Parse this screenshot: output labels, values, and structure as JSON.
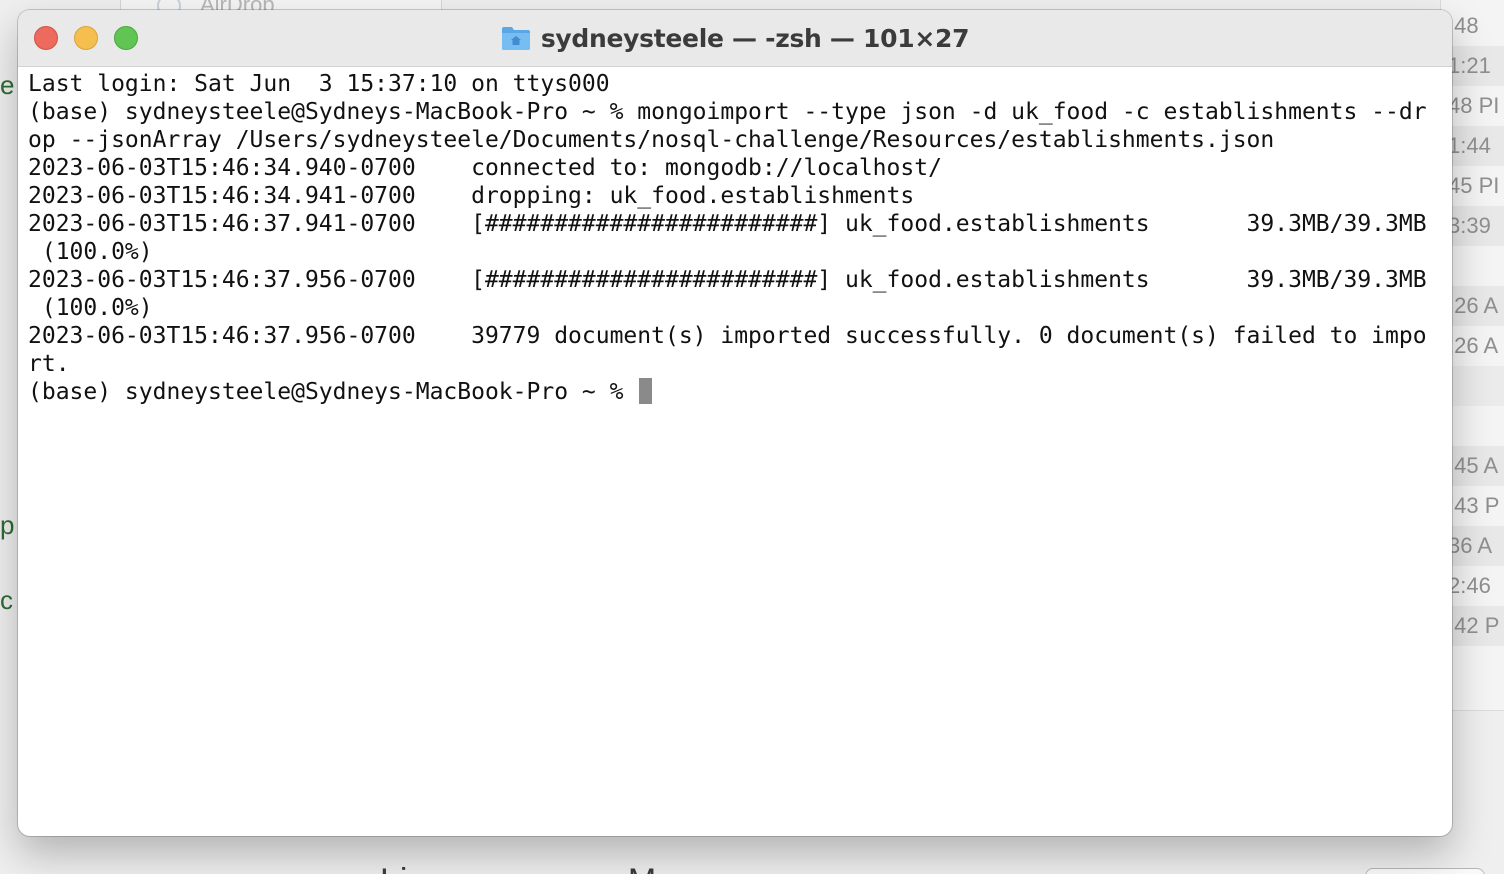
{
  "background": {
    "finder_label": "AirDrop",
    "right_list_times": [
      ":48",
      "1:21",
      "48 PI",
      "1:44",
      "45 PI",
      "3:39",
      "",
      ":26 A",
      ":26 A",
      "",
      "",
      ":45 A",
      ":43 P",
      "36 A",
      "2:46",
      ":42 P"
    ],
    "left_fragments": [
      "e",
      "p",
      "c"
    ],
    "bottom_text": "Li  ... ... ...  ...  ...  M... ...  ... ..."
  },
  "terminal": {
    "title": "sydneysteele — -zsh — 101×27",
    "colors": {
      "close": "#ed6a5e",
      "minimize": "#f5bf4f",
      "zoom": "#61c554",
      "cursor": "#8a8a8a"
    },
    "lines": [
      "Last login: Sat Jun  3 15:37:10 on ttys000",
      "(base) sydneysteele@Sydneys-MacBook-Pro ~ % mongoimport --type json -d uk_food -c establishments --dr",
      "op --jsonArray /Users/sydneysteele/Documents/nosql-challenge/Resources/establishments.json",
      "2023-06-03T15:46:34.940-0700    connected to: mongodb://localhost/",
      "2023-06-03T15:46:34.941-0700    dropping: uk_food.establishments",
      "2023-06-03T15:46:37.941-0700    [########################] uk_food.establishments       39.3MB/39.3MB",
      " (100.0%)",
      "2023-06-03T15:46:37.956-0700    [########################] uk_food.establishments       39.3MB/39.3MB",
      " (100.0%)",
      "2023-06-03T15:46:37.956-0700    39779 document(s) imported successfully. 0 document(s) failed to impo",
      "rt."
    ],
    "prompt": "(base) sydneysteele@Sydneys-MacBook-Pro ~ % "
  }
}
